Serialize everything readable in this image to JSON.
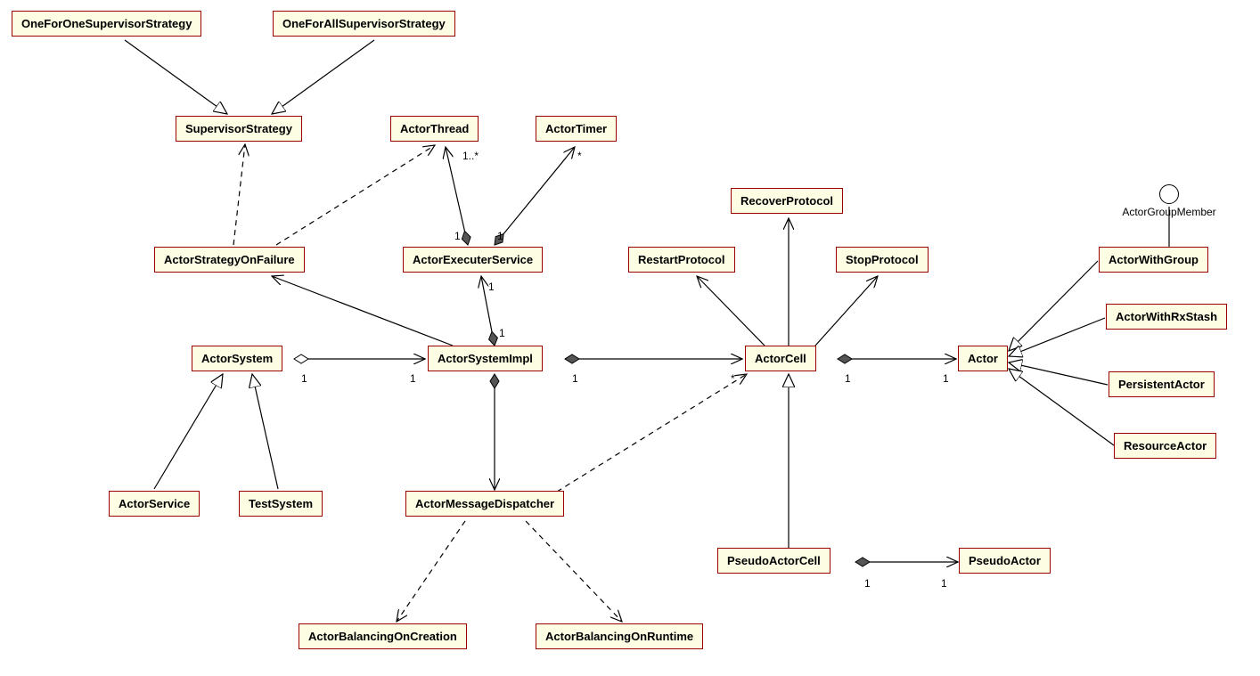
{
  "classes": {
    "oneForOne": "OneForOneSupervisorStrategy",
    "oneForAll": "OneForAllSupervisorStrategy",
    "supervisorStrategy": "SupervisorStrategy",
    "actorThread": "ActorThread",
    "actorTimer": "ActorTimer",
    "actorStrategyOnFailure": "ActorStrategyOnFailure",
    "actorExecuterService": "ActorExecuterService",
    "restartProtocol": "RestartProtocol",
    "recoverProtocol": "RecoverProtocol",
    "stopProtocol": "StopProtocol",
    "actorSystem": "ActorSystem",
    "actorSystemImpl": "ActorSystemImpl",
    "actorCell": "ActorCell",
    "actor": "Actor",
    "actorWithGroup": "ActorWithGroup",
    "actorWithRxStash": "ActorWithRxStash",
    "persistentActor": "PersistentActor",
    "resourceActor": "ResourceActor",
    "actorService": "ActorService",
    "testSystem": "TestSystem",
    "actorMessageDispatcher": "ActorMessageDispatcher",
    "pseudoActorCell": "PseudoActorCell",
    "pseudoActor": "PseudoActor",
    "actorBalancingOnCreation": "ActorBalancingOnCreation",
    "actorBalancingOnRuntime": "ActorBalancingOnRuntime"
  },
  "interface": {
    "actorGroupMember": "ActorGroupMember"
  },
  "mult": {
    "m1": "1",
    "m1star": "1..*",
    "mstar": "*"
  }
}
